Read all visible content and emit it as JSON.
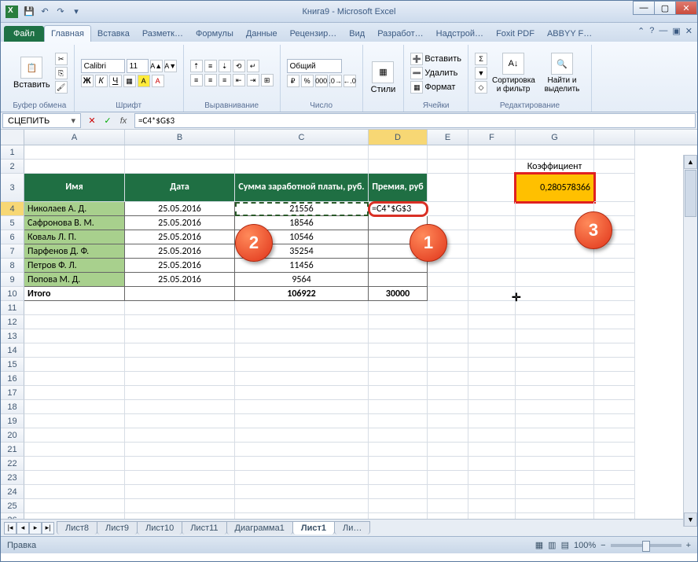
{
  "window": {
    "title": "Книга9 - Microsoft Excel"
  },
  "tabs": {
    "file": "Файл",
    "list": [
      "Главная",
      "Вставка",
      "Разметк…",
      "Формулы",
      "Данные",
      "Рецензир…",
      "Вид",
      "Разработ…",
      "Надстрой…",
      "Foxit PDF",
      "ABBYY F…"
    ],
    "active_index": 0
  },
  "ribbon": {
    "clipboard": {
      "paste": "Вставить",
      "label": "Буфер обмена"
    },
    "font": {
      "name": "Calibri",
      "size": "11",
      "label": "Шрифт"
    },
    "align": {
      "label": "Выравнивание"
    },
    "number": {
      "format": "Общий",
      "label": "Число"
    },
    "styles": {
      "btn": "Стили",
      "label": ""
    },
    "cells": {
      "insert": "Вставить",
      "delete": "Удалить",
      "format": "Формат",
      "label": "Ячейки"
    },
    "editing": {
      "sort": "Сортировка и фильтр",
      "find": "Найти и выделить",
      "label": "Редактирование"
    }
  },
  "namebox": "СЦЕПИТЬ",
  "formula": "=C4*$G$3",
  "cols": [
    "A",
    "B",
    "C",
    "D",
    "E",
    "F",
    "G"
  ],
  "headers": {
    "name": "Имя",
    "date": "Дата",
    "salary": "Сумма заработной платы, руб.",
    "bonus": "Премия, руб"
  },
  "coef": {
    "label": "Коэффициент",
    "value": "0,280578366"
  },
  "rows": [
    {
      "n": "Николаев А. Д.",
      "d": "25.05.2016",
      "s": "21556"
    },
    {
      "n": "Сафронова В. М.",
      "d": "25.05.2016",
      "s": "18546"
    },
    {
      "n": "Коваль Л. П.",
      "d": "25.05.2016",
      "s": "10546"
    },
    {
      "n": "Парфенов Д. Ф.",
      "d": "25.05.2016",
      "s": "35254"
    },
    {
      "n": "Петров Ф. Л.",
      "d": "25.05.2016",
      "s": "11456"
    },
    {
      "n": "Попова М. Д.",
      "d": "25.05.2016",
      "s": "9564"
    }
  ],
  "total": {
    "label": "Итого",
    "salary": "106922",
    "bonus": "30000"
  },
  "editing_cell": "=C4*$G$3",
  "sheets": {
    "list": [
      "Лист8",
      "Лист9",
      "Лист10",
      "Лист11",
      "Диаграмма1",
      "Лист1",
      "Ли…"
    ],
    "active_index": 5
  },
  "status": {
    "mode": "Правка",
    "zoom": "100%"
  },
  "callouts": [
    "1",
    "2",
    "3"
  ]
}
